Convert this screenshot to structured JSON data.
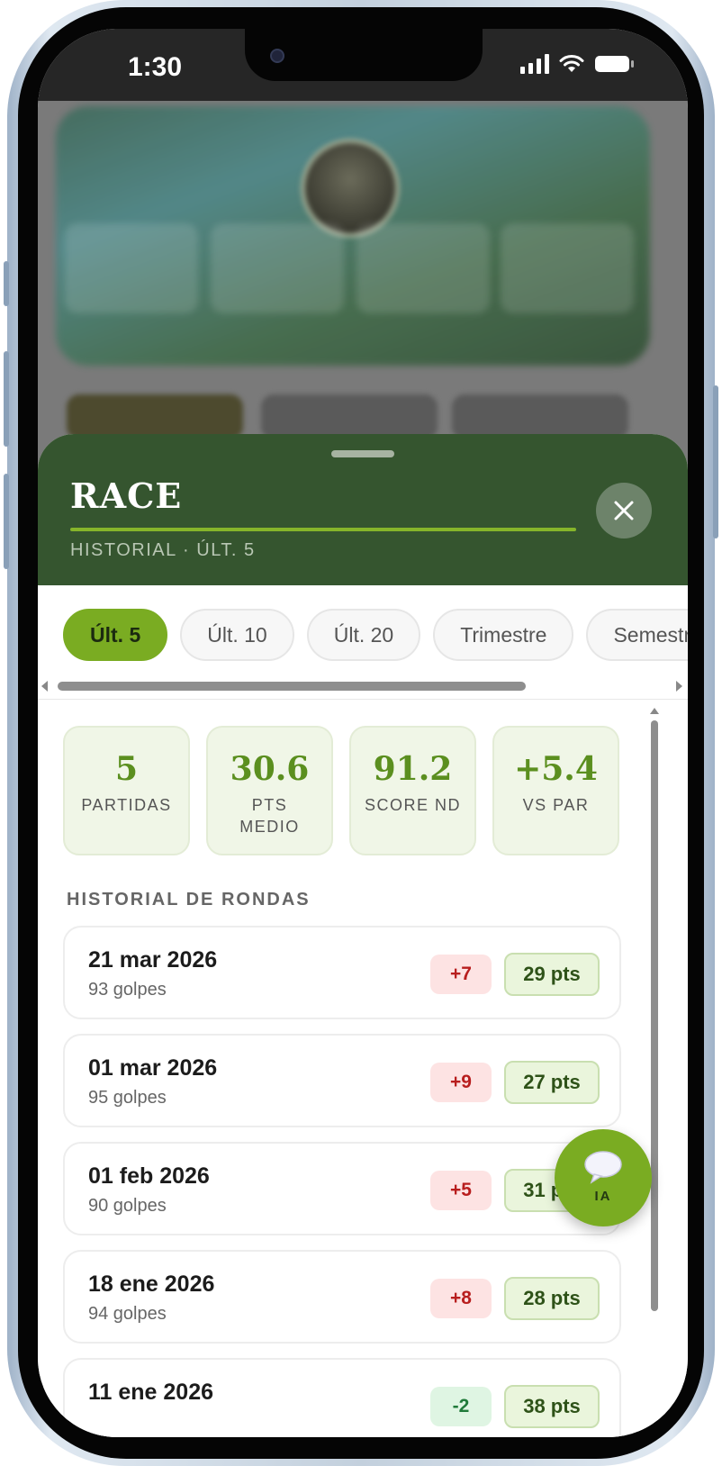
{
  "status_bar": {
    "time": "1:30"
  },
  "sheet": {
    "title": "RACE",
    "subtitle": "HISTORIAL · ÚLT. 5"
  },
  "filters": {
    "tabs": [
      "Últ. 5",
      "Últ. 10",
      "Últ. 20",
      "Trimestre",
      "Semestre"
    ],
    "active": "Últ. 5"
  },
  "stats": [
    {
      "value": "5",
      "label": "PARTIDAS"
    },
    {
      "value": "30.6",
      "label": "PTS MEDIO"
    },
    {
      "value": "91.2",
      "label": "SCORE ND"
    },
    {
      "value": "+5.4",
      "label": "VS PAR"
    }
  ],
  "history": {
    "section_label": "HISTORIAL DE RONDAS",
    "rounds": [
      {
        "date": "21 mar 2026",
        "strokes": "93 golpes",
        "vs_par": "+7",
        "points": "29 pts"
      },
      {
        "date": "01 mar 2026",
        "strokes": "95 golpes",
        "vs_par": "+9",
        "points": "27 pts"
      },
      {
        "date": "01 feb 2026",
        "strokes": "90 golpes",
        "vs_par": "+5",
        "points": "31 pts"
      },
      {
        "date": "18 ene 2026",
        "strokes": "94 golpes",
        "vs_par": "+8",
        "points": "28 pts"
      },
      {
        "date": "11 ene 2026",
        "strokes": "",
        "vs_par": "-2",
        "points": "38 pts"
      }
    ]
  },
  "fab": {
    "label": "IA",
    "icon": "speech-bubble-icon"
  },
  "colors": {
    "header_green": "#35552f",
    "accent_green": "#7aac22",
    "over_par": "#b81e1e",
    "under_par": "#207a3a"
  }
}
